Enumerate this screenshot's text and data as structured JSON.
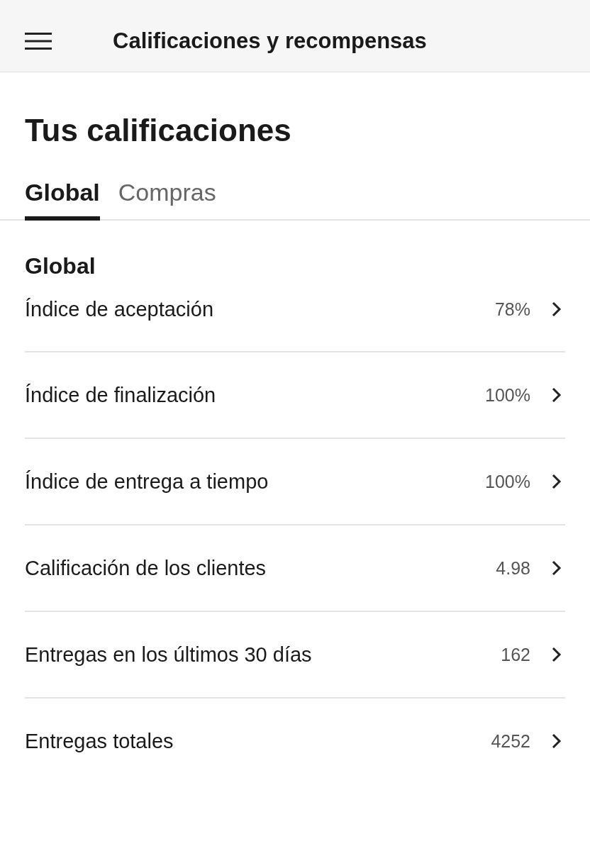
{
  "header": {
    "title": "Calificaciones y recompensas"
  },
  "page_title": "Tus calificaciones",
  "tabs": [
    {
      "label": "Global",
      "selected": true
    },
    {
      "label": "Compras",
      "selected": false
    }
  ],
  "section": {
    "title": "Global"
  },
  "rows": [
    {
      "label": "Índice de aceptación",
      "value": "78%"
    },
    {
      "label": "Índice de finalización",
      "value": "100%"
    },
    {
      "label": "Índice de entrega a tiempo",
      "value": "100%"
    },
    {
      "label": "Calificación de los clientes",
      "value": "4.98"
    },
    {
      "label": "Entregas en los últimos 30 días",
      "value": "162"
    },
    {
      "label": "Entregas totales",
      "value": "4252"
    }
  ]
}
